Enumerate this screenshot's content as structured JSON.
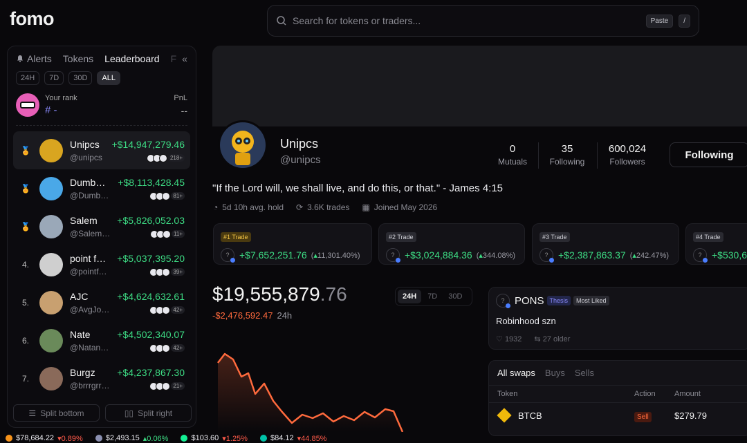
{
  "app": {
    "logo": "fomo"
  },
  "search": {
    "placeholder": "Search for tokens or traders...",
    "paste": "Paste",
    "slash": "/"
  },
  "sidebar": {
    "tabs": [
      "Alerts",
      "Tokens",
      "Leaderboard",
      "F"
    ],
    "ranges": [
      "24H",
      "7D",
      "30D",
      "ALL"
    ],
    "your_rank_label": "Your rank",
    "your_rank_value": "# -",
    "pnl_label": "PnL",
    "pnl_value": "--",
    "rows": [
      {
        "rank": "1",
        "name": "Unipcs",
        "handle": "@unipcs",
        "pnl": "+$14,947,279.46",
        "count": "218+"
      },
      {
        "rank": "2",
        "name": "Dumb…",
        "handle": "@Dumb…",
        "pnl": "+$8,113,428.45",
        "count": "81+"
      },
      {
        "rank": "3",
        "name": "Salem",
        "handle": "@Salem…",
        "pnl": "+$5,826,052.03",
        "count": "11+"
      },
      {
        "rank": "4.",
        "name": "point f…",
        "handle": "@pointf…",
        "pnl": "+$5,037,395.20",
        "count": "39+"
      },
      {
        "rank": "5.",
        "name": "AJC",
        "handle": "@AvgJo…",
        "pnl": "+$4,624,632.61",
        "count": "42+"
      },
      {
        "rank": "6.",
        "name": "Nate",
        "handle": "@Natan…",
        "pnl": "+$4,502,340.07",
        "count": "42+"
      },
      {
        "rank": "7.",
        "name": "Burgz",
        "handle": "@brrrgrr…",
        "pnl": "+$4,237,867.30",
        "count": "21+"
      }
    ],
    "split_bottom": "Split bottom",
    "split_right": "Split right"
  },
  "profile": {
    "name": "Unipcs",
    "handle": "@unipcs",
    "stats": [
      {
        "n": "0",
        "l": "Mutuals"
      },
      {
        "n": "35",
        "l": "Following"
      },
      {
        "n": "600,024",
        "l": "Followers"
      }
    ],
    "follow_button": "Following",
    "bio": "\"If the Lord will, we shall live, and do this, or that.\" - James 4:15",
    "meta": [
      "5d 10h avg. hold",
      "3.6K trades",
      "Joined May 2026"
    ]
  },
  "trades": [
    {
      "label": "#1 Trade",
      "amount": "+$7,652,251.76",
      "pct": "11,301.40%"
    },
    {
      "label": "#2 Trade",
      "amount": "+$3,024,884.36",
      "pct": "344.08%"
    },
    {
      "label": "#3 Trade",
      "amount": "+$2,387,863.37",
      "pct": "242.47%"
    },
    {
      "label": "#4 Trade",
      "amount": "+$530,6",
      "pct": ""
    }
  ],
  "balance": {
    "main": "$19,555,879",
    "decimal": ".76",
    "change": "-$2,476,592.47",
    "period": "24h",
    "ranges": [
      "24H",
      "7D",
      "30D"
    ]
  },
  "post": {
    "token": "PONS",
    "tag1": "Thesis",
    "tag2": "Most Liked",
    "text": "Robinhood szn",
    "likes": "1932",
    "older": "27 older"
  },
  "swaps": {
    "tabs": [
      "All swaps",
      "Buys",
      "Sells"
    ],
    "headers": [
      "Token",
      "Action",
      "Amount"
    ],
    "row": {
      "token": "BTCB",
      "action": "Sell",
      "amount": "$279.79"
    }
  },
  "ticker": [
    {
      "price": "$78,684.22",
      "change": "0.89%",
      "color": "#f7931a"
    },
    {
      "price": "$2,493.15",
      "change": "0.06%",
      "color": "#8a8fb0"
    },
    {
      "price": "$103.60",
      "change": "1.25%",
      "color": "#14f195"
    },
    {
      "price": "$84.12",
      "change": "44.85%",
      "color": "#00c2a8"
    }
  ],
  "colors": {
    "green": "#3ddc84",
    "red": "#ff5a4a",
    "orange": "#ff6a3d"
  }
}
